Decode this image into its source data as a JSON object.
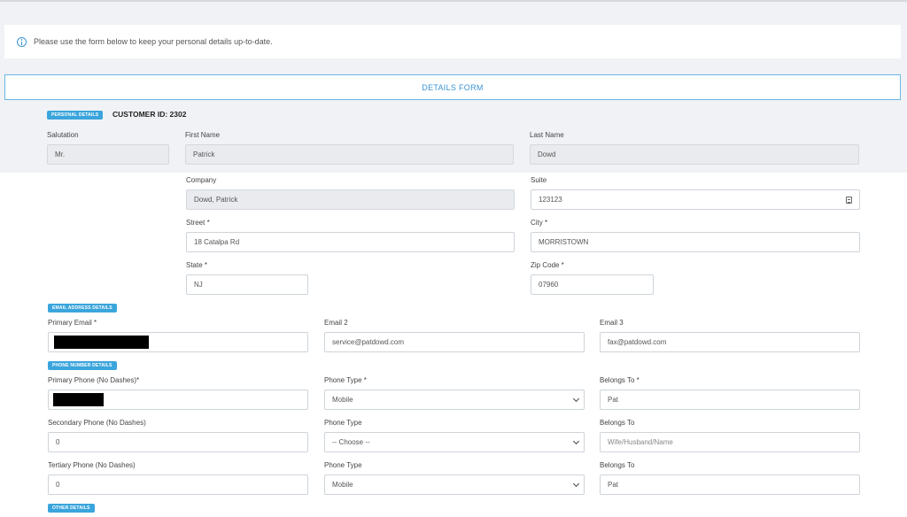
{
  "info": {
    "message": "Please use the form below to keep your personal details up-to-date."
  },
  "form": {
    "title": "DETAILS FORM"
  },
  "personal": {
    "badge": "PERSONAL DETAILS",
    "customer_id": "CUSTOMER ID: 2302",
    "salutation_label": "Salutation",
    "salutation_value": "Mr.",
    "first_name_label": "First Name",
    "first_name_value": "Patrick",
    "last_name_label": "Last Name",
    "last_name_value": "Dowd",
    "company_label": "Company",
    "company_value": "Dowd, Patrick",
    "suite_label": "Suite",
    "suite_value": "123123",
    "street_label": "Street *",
    "street_value": "18 Catalpa Rd",
    "city_label": "City *",
    "city_value": "MORRISTOWN",
    "state_label": "State *",
    "state_value": "NJ",
    "zip_label": "Zip Code *",
    "zip_value": "07960"
  },
  "email": {
    "badge": "EMAIL ADDRESS DETAILS",
    "primary_label": "Primary Email *",
    "email2_label": "Email 2",
    "email2_value": "service@patdowd.com",
    "email3_label": "Email 3",
    "email3_value": "fax@patdowd.com"
  },
  "phone": {
    "badge": "PHONE NUMBER DETAILS",
    "primary_label": "Primary Phone (No Dashes)*",
    "type1_label": "Phone Type *",
    "type1_value": "Mobile",
    "belongs1_label": "Belongs To *",
    "belongs1_value": "Pat",
    "secondary_label": "Secondary Phone (No Dashes)",
    "secondary_value": "0",
    "type2_label": "Phone Type",
    "type2_value": "-- Choose --",
    "belongs2_label": "Belongs To",
    "belongs2_placeholder": "Wife/Husband/Name",
    "tertiary_label": "Tertiary Phone (No Dashes)",
    "tertiary_value": "0",
    "type3_label": "Phone Type",
    "type3_value": "Mobile",
    "belongs3_label": "Belongs To",
    "belongs3_value": "Pat"
  },
  "other": {
    "badge": "OTHER DETAILS"
  }
}
